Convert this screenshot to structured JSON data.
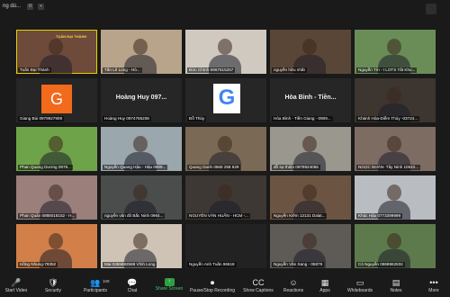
{
  "window": {
    "status": "ng dù...",
    "controls": [
      "II",
      "▪"
    ]
  },
  "tiles": [
    {
      "name": "Tuấn Đại Thành",
      "bg": "#6d4a3a",
      "active": true,
      "banner": "TUẤN ĐẠI THÀNH"
    },
    {
      "name": "Tấn Lê Long - Hò...",
      "bg": "#b8a48a"
    },
    {
      "name": "Đức Chính-0967515257",
      "bg": "#cfc9c0"
    },
    {
      "name": "nguyễn hữu nhất",
      "bg": "#5a4636"
    },
    {
      "name": "Nguyễn Tín - I LOTS Tất Khu...",
      "bg": "#6a8d58"
    },
    {
      "name": "Giang Bùi 0979927909",
      "bg": "#262626",
      "avatar": "G",
      "avatar_color": "#f26a1b"
    },
    {
      "name": "Hoàng Huy 0974765208",
      "bg": "#262626",
      "bigtext": "Hoàng Huy 097..."
    },
    {
      "name": "Đỗ Thủy",
      "bg": "#262626",
      "google": "G"
    },
    {
      "name": "Hòa Bình - Tiền Giang - 0909...",
      "bg": "#262626",
      "bigtext": "Hòa Bình - Tiền..."
    },
    {
      "name": "Khánh Hòa-Diễm Thúy -03724...",
      "bg": "#3c3530"
    },
    {
      "name": "Phan Quang Dương 0979...",
      "bg": "#6fa349"
    },
    {
      "name": "Nguyễn Quang Hậu - Hậu 0909...",
      "bg": "#9aa7ad"
    },
    {
      "name": "Quang Danh 0568 258 829",
      "bg": "#7a6a55"
    },
    {
      "name": "đỗ sự thiện 0979924055",
      "bg": "#9a978f"
    },
    {
      "name": "NGỌC NHÂN- Tây Ninh 10610...",
      "bg": "#7d6c62"
    },
    {
      "name": "Phan Quân 0888018152 - H...",
      "bg": "#9a7f7a"
    },
    {
      "name": "nguyễn văn đô Bắc Ninh 0964...",
      "bg": "#4a4d4c"
    },
    {
      "name": "NGUYỄN VĂN HUẤN - HCM -...",
      "bg": "#3d3833"
    },
    {
      "name": "Nguyễn Kiếm 13131 Dalat...",
      "bg": "#6b5542"
    },
    {
      "name": "Khúc Hậu 0773399999",
      "bg": "#b9bdc1"
    },
    {
      "name": "Hồng Nhung-79352",
      "bg": "#d27f49"
    },
    {
      "name": "Mai 0355882569 Vĩnh Long",
      "bg": "#cfc3b6"
    },
    {
      "name": "Nguyễn Anh Tuấn 96618",
      "bg": "#222222"
    },
    {
      "name": "Nguyễn Văn Sang - 05879",
      "bg": "#5e5a55"
    },
    {
      "name": "Cỏ Nguyễn 0868962832",
      "bg": "#5d7a4c"
    }
  ],
  "toolbar": [
    {
      "icon": "🎤",
      "label": "Start Video"
    },
    {
      "icon": "🛡",
      "label": "Security"
    },
    {
      "icon": "👥",
      "label": "Participants",
      "count": "109"
    },
    {
      "icon": "💬",
      "label": "Chat"
    },
    {
      "icon": "↑",
      "label": "Share Screen",
      "accent": "#2ea043"
    },
    {
      "icon": "⏺",
      "label": "Pause/Stop Recording"
    },
    {
      "icon": "CC",
      "label": "Show Captions"
    },
    {
      "icon": "☺",
      "label": "Reactions"
    },
    {
      "icon": "▦",
      "label": "Apps"
    },
    {
      "icon": "▭",
      "label": "Whiteboards"
    },
    {
      "icon": "▤",
      "label": "Notes"
    },
    {
      "icon": "•••",
      "label": "More"
    }
  ]
}
